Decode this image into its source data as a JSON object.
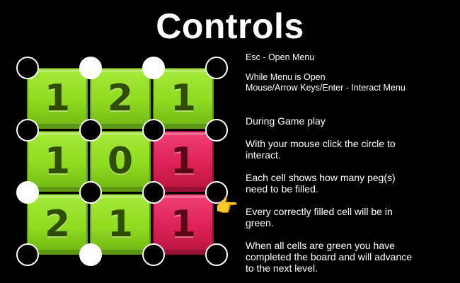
{
  "title": "Controls",
  "board": {
    "cells": [
      {
        "value": "1",
        "color": "green"
      },
      {
        "value": "2",
        "color": "green"
      },
      {
        "value": "1",
        "color": "green"
      },
      {
        "value": "1",
        "color": "green"
      },
      {
        "value": "0",
        "color": "green"
      },
      {
        "value": "1",
        "color": "red"
      },
      {
        "value": "2",
        "color": "green"
      },
      {
        "value": "1",
        "color": "green"
      },
      {
        "value": "1",
        "color": "red"
      }
    ],
    "pegs": [
      [
        false,
        true,
        true,
        false
      ],
      [
        false,
        false,
        false,
        false
      ],
      [
        true,
        false,
        false,
        false
      ],
      [
        false,
        true,
        false,
        false
      ]
    ],
    "colors": {
      "green": "#8fdc20",
      "red": "#dd2157",
      "peg_filled": "#ffffff",
      "peg_empty": "#000000"
    }
  },
  "pointer_icon": "hand-pointer-icon",
  "instructions": {
    "esc": "Esc - Open Menu",
    "menu_open": "While Menu is Open",
    "menu_keys": "Mouse/Arrow Keys/Enter - Interact Menu",
    "gameplay": "During Game play",
    "mouse_1": "With your mouse click the circle to",
    "mouse_2": "interact.",
    "cells_1": "Each cell shows how many peg(s)",
    "cells_2": "need to be filled.",
    "correct_1": "Every correctly filled cell will be in",
    "correct_2": "green.",
    "complete_1": "When all cells are green you have",
    "complete_2": "completed the board and will advance",
    "complete_3": "to the next level."
  }
}
